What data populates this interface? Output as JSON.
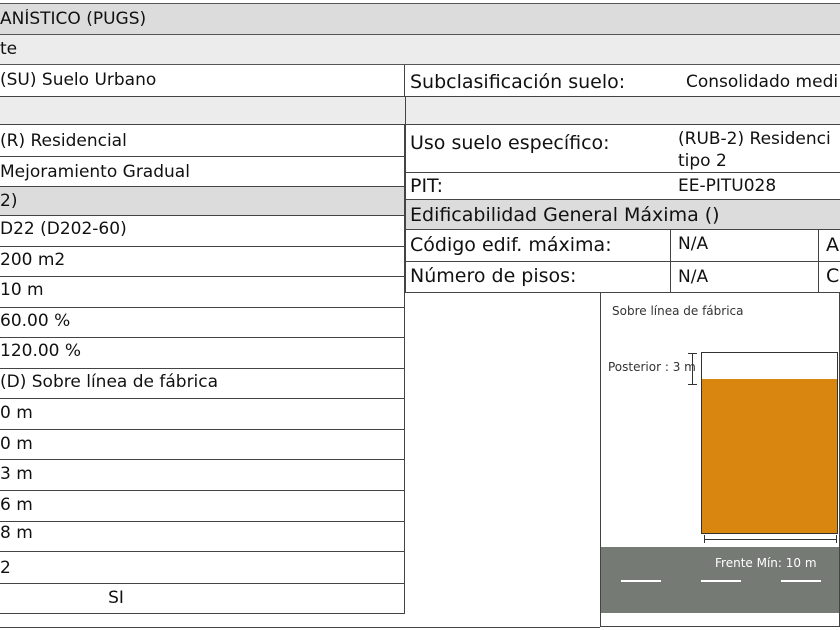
{
  "section_title": "ANÍSTICO (PUGS)",
  "subtitle": "te",
  "clasificacion": {
    "value": "(SU) Suelo Urbano",
    "sub_label": "Subclasificación suelo:",
    "sub_value": "Consolidado medi"
  },
  "uso": {
    "value": "(R) Residencial",
    "especifico_label": "Uso suelo específico:",
    "especifico_value_line1": "(RUB-2) Residenci",
    "especifico_value_line2": "tipo 2"
  },
  "tratamiento": "Mejoramiento Gradual",
  "pit": {
    "label": "PIT:",
    "value": "EE-PITU028"
  },
  "group_header": "2)",
  "edificabilidad_header": "Edificabilidad General Máxima ()",
  "codigo": {
    "label": "Código edif. máxima:",
    "value": "N/A",
    "extra": "A"
  },
  "pisos": {
    "label": "Número de pisos:",
    "value": "N/A",
    "extra": "C"
  },
  "left_values": [
    "D22 (D202-60)",
    "200 m2",
    "10 m",
    "60.00 %",
    "120.00 %",
    "(D) Sobre línea de fábrica",
    "0 m",
    "0 m",
    "3 m",
    "6 m",
    "8 m",
    "2",
    "SI"
  ],
  "diagram": {
    "title": "Sobre línea de fábrica",
    "posterior_label": "Posterior : 3 m",
    "frente_label": "Frente Mín: 10 m",
    "building_color": "#d8860f",
    "road_color": "#757a75"
  }
}
